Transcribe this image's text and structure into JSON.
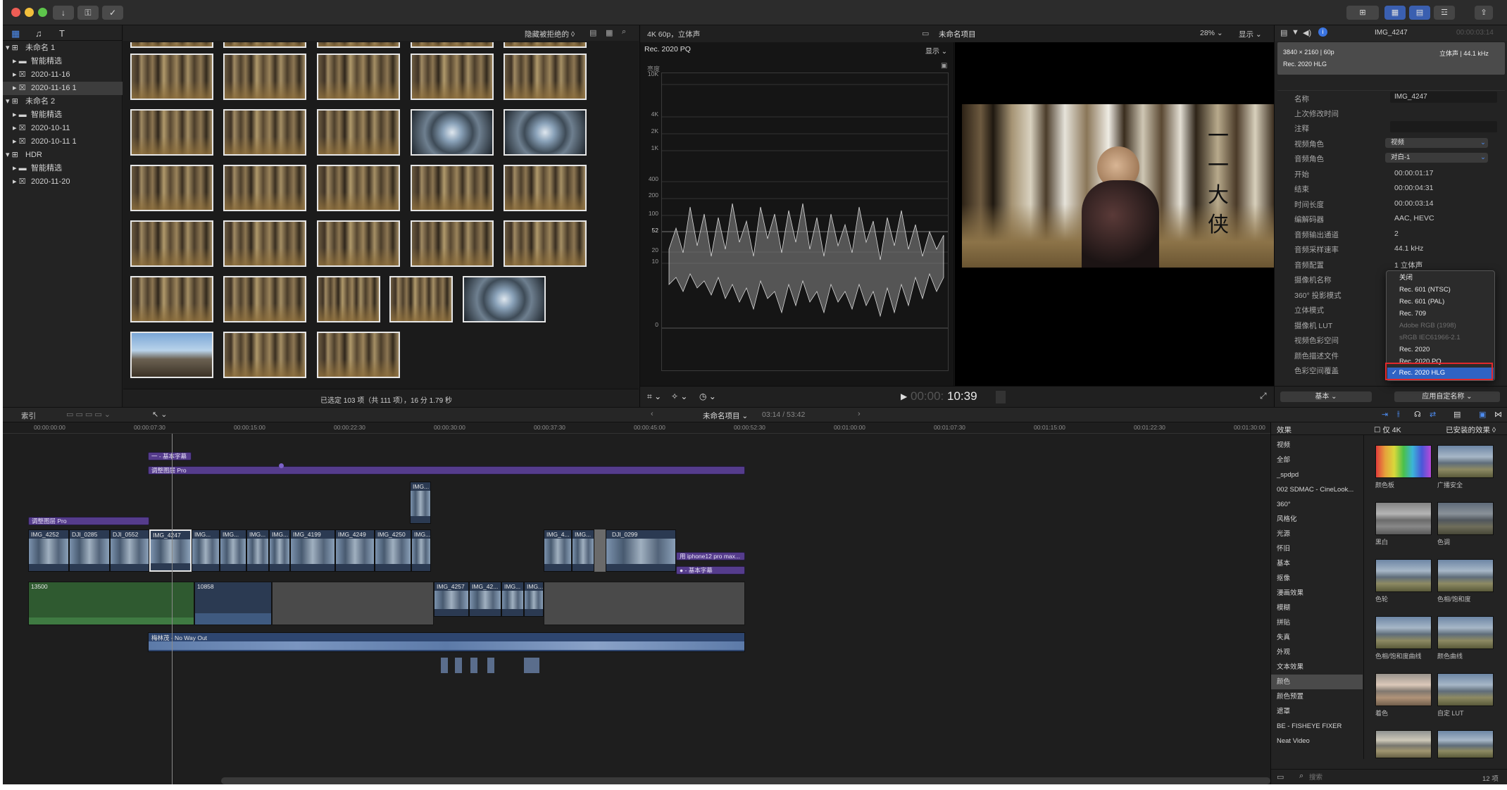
{
  "titlebar": {
    "buttons": [
      "↓",
      "⚿",
      "✓"
    ],
    "right_buttons": [
      "⊞",
      "▦",
      "▤",
      "☲",
      "⇪"
    ]
  },
  "library": {
    "items": [
      {
        "label": "未命名 1",
        "kind": "library"
      },
      {
        "label": "智能精选",
        "kind": "folder"
      },
      {
        "label": "2020-11-16",
        "kind": "event"
      },
      {
        "label": "2020-11-16 1",
        "kind": "event",
        "selected": true
      },
      {
        "label": "未命名 2",
        "kind": "library"
      },
      {
        "label": "智能精选",
        "kind": "folder"
      },
      {
        "label": "2020-10-11",
        "kind": "event"
      },
      {
        "label": "2020-10-11 1",
        "kind": "event"
      },
      {
        "label": "HDR",
        "kind": "library"
      },
      {
        "label": "智能精选",
        "kind": "folder"
      },
      {
        "label": "2020-11-20",
        "kind": "event"
      }
    ]
  },
  "browser": {
    "filter_label": "隐藏被拒绝的 ◊",
    "status": "已选定 103 项（共 111 项），16 分 1.79 秒"
  },
  "viewer": {
    "format": "4K 60p，立体声",
    "project": "未命名项目",
    "zoom": "28% ⌄",
    "display": "显示 ⌄",
    "scope_title": "Rec. 2020 PQ",
    "scope_display": "显示 ⌄",
    "scope_unit": "亮度",
    "scope_ticks": [
      "10K",
      "4K",
      "2K",
      "1K",
      "400",
      "200",
      "100",
      "52",
      "20",
      "10",
      "0"
    ],
    "subtitle_chars": [
      "一",
      "一",
      "大",
      "侠"
    ],
    "timecode_prefix": "00:00:",
    "timecode": "10:39"
  },
  "inspector": {
    "clip_name": "IMG_4247",
    "clip_time": "00:00:03:14",
    "resolution": "3840 × 2160 | 60p",
    "audio_summary": "立体声 | 44.1 kHz",
    "color_space": "Rec. 2020 HLG",
    "rows": [
      {
        "label": "名称",
        "value": "IMG_4247"
      },
      {
        "label": "上次修改时间",
        "value": ""
      },
      {
        "label": "注释",
        "value": ""
      },
      {
        "label": "视频角色",
        "value": "视频"
      },
      {
        "label": "音频角色",
        "value": "对白-1"
      },
      {
        "label": "开始",
        "value": "00:00:01:17"
      },
      {
        "label": "结束",
        "value": "00:00:04:31"
      },
      {
        "label": "时间长度",
        "value": "00:00:03:14"
      },
      {
        "label": "编解码器",
        "value": "AAC, HEVC"
      },
      {
        "label": "音频输出通道",
        "value": "2"
      },
      {
        "label": "音频采样速率",
        "value": "44.1 kHz"
      },
      {
        "label": "音频配置",
        "value": "1 立体声"
      },
      {
        "label": "摄像机名称",
        "value": ""
      },
      {
        "label": "360° 投影模式",
        "value": ""
      },
      {
        "label": "立体模式",
        "value": ""
      },
      {
        "label": "摄像机 LUT",
        "value": ""
      },
      {
        "label": "视频色彩空间",
        "value": ""
      },
      {
        "label": "颜色描述文件",
        "value": ""
      },
      {
        "label": "色彩空间覆盖",
        "value": ""
      }
    ],
    "footer_left": "基本 ⌄",
    "footer_right": "应用自定名称 ⌄"
  },
  "colorspace_menu": {
    "items": [
      {
        "label": "关闭",
        "state": "normal"
      },
      {
        "label": "Rec. 601 (NTSC)",
        "state": "normal"
      },
      {
        "label": "Rec. 601 (PAL)",
        "state": "normal"
      },
      {
        "label": "Rec. 709",
        "state": "normal"
      },
      {
        "label": "Adobe RGB (1998)",
        "state": "disabled"
      },
      {
        "label": "sRGB IEC61966-2.1",
        "state": "disabled"
      },
      {
        "label": "Rec. 2020",
        "state": "normal"
      },
      {
        "label": "Rec. 2020 PQ",
        "state": "normal"
      },
      {
        "label": "✓ Rec. 2020 HLG",
        "state": "selected"
      }
    ]
  },
  "timeline": {
    "index_label": "索引",
    "project": "未命名项目 ⌄",
    "duration": "03:14 / 53:42",
    "ruler": [
      "00:00:00:00",
      "00:00:07:30",
      "00:00:15:00",
      "00:00:22:30",
      "00:00:30:00",
      "00:00:37:30",
      "00:00:45:00",
      "00:00:52:30",
      "00:01:00:00",
      "00:01:07:30",
      "00:01:15:00",
      "00:01:22:30",
      "00:01:30:00"
    ],
    "titles": {
      "top": "一 - 基本字幕",
      "adjust_top": "调整图层 Pro",
      "adjust_left": "调整图层 Pro",
      "iphone": "用 iphone12 pro max...",
      "title2": "● - 基本字幕",
      "music": "梅林茂 - No Way Out"
    },
    "connected_clip": "IMG...",
    "main_clips": [
      "IMG_4252",
      "DJI_0285",
      "DJI_0552",
      "IMG_4247",
      "IMG...",
      "IMG...",
      "IMG...",
      "IMG...",
      "IMG_4199",
      "IMG_4249",
      "IMG_4250",
      "IMG..."
    ],
    "right_clips": [
      "IMG_4...",
      "IMG...",
      "DJI_0299"
    ],
    "lower_clips": [
      "13500",
      "10858",
      "IMG_4257",
      "IMG_42...",
      "IMG...",
      "IMG..."
    ]
  },
  "effects": {
    "header": "效果",
    "only4k": "仅 4K",
    "installed": "已安装的效果 ◊",
    "categories": [
      "视频",
      "全部",
      "_spdpd",
      "002 SDMAC - CineLook...",
      "360°",
      "风格化",
      "光源",
      "怀旧",
      "基本",
      "抠像",
      "漫画效果",
      "模糊",
      "拼贴",
      "失真",
      "外观",
      "文本效果",
      "颜色",
      "颜色预置",
      "遮罩",
      "BE - FISHEYE FIXER",
      "Neat Video"
    ],
    "selected_category": "颜色",
    "items": [
      "颜色板",
      "广播安全",
      "黑白",
      "色调",
      "色轮",
      "色相/饱和度",
      "色相/饱和度曲线",
      "颜色曲线",
      "着色",
      "自定 LUT",
      "",
      ""
    ],
    "search_placeholder": "搜索",
    "count": "12 项"
  }
}
